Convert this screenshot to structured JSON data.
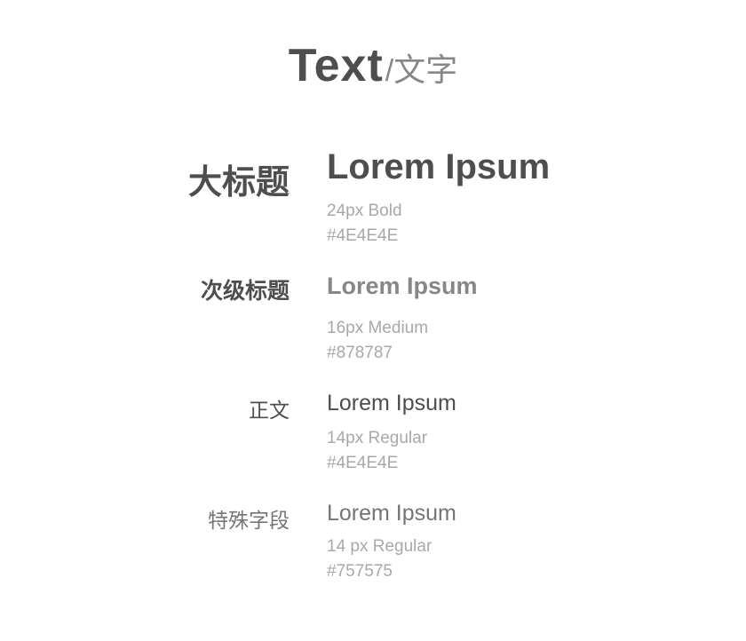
{
  "title": {
    "en": "Text",
    "separator": "/",
    "zh": "文字"
  },
  "rows": [
    {
      "label": "大标题",
      "sample": "Lorem Ipsum",
      "spec": "24px Bold",
      "color_text": "#4E4E4E",
      "color": "#4E4E4E"
    },
    {
      "label": "次级标题",
      "sample": "Lorem Ipsum",
      "spec": "16px Medium",
      "color_text": "#878787",
      "color": "#878787"
    },
    {
      "label": "正文",
      "sample": "Lorem Ipsum",
      "spec": "14px Regular",
      "color_text": "#4E4E4E",
      "color": "#4E4E4E"
    },
    {
      "label": "特殊字段",
      "sample": "Lorem Ipsum",
      "spec": "14 px Regular",
      "color_text": "#757575",
      "color": "#757575"
    }
  ],
  "colors": {
    "primary_text": "#4E4E4E",
    "secondary_text": "#878787",
    "special_text": "#757575",
    "meta_text": "#A8A8A8",
    "background": "#FFFFFF"
  }
}
